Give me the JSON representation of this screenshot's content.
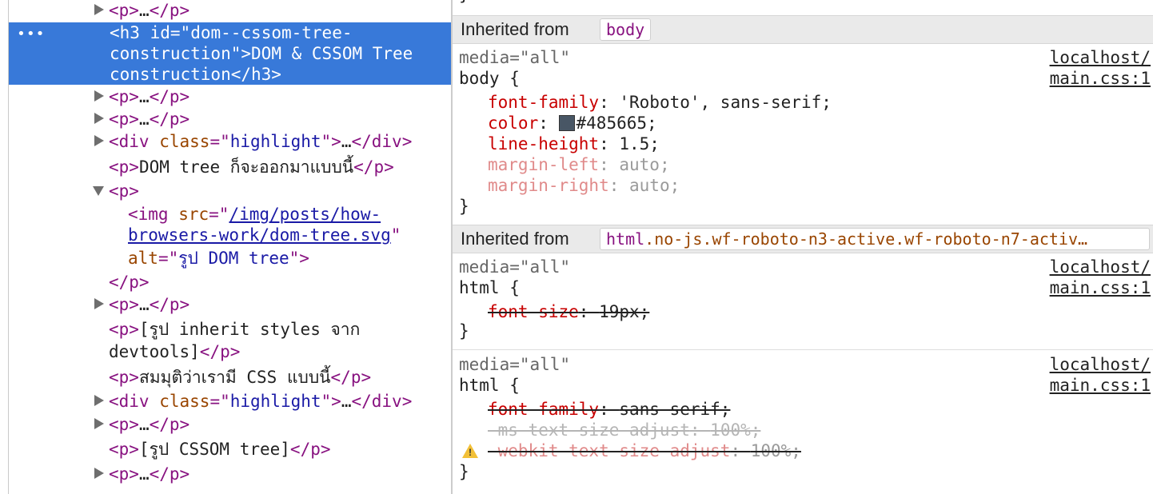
{
  "dom": {
    "line0": {
      "open": "<p>",
      "ellipsis": "…",
      "close": "</p>"
    },
    "selected": {
      "dots": "•••",
      "line1": {
        "open": "<h3 ",
        "attr": "id",
        "eq": "=",
        "q1": "\"",
        "val": "dom--cssom-tree-"
      },
      "line2": {
        "val": "construction",
        "q2": "\"",
        "gt": ">",
        "text": "DOM & CSSOM Tree"
      },
      "line3": {
        "text": "construction",
        "close": "</h3>"
      }
    },
    "line4": {
      "open": "<p>",
      "ellipsis": "…",
      "close": "</p>"
    },
    "line5": {
      "open": "<p>",
      "ellipsis": "…",
      "close": "</p>"
    },
    "line6": {
      "open": "<div ",
      "attr": "class",
      "eq": "=\"",
      "val": "highlight",
      "q": "\">",
      "ellipsis": "…",
      "close": "</div>"
    },
    "line7": {
      "open": "<p>",
      "text": "DOM tree ก็จะออกมาแบบนี้",
      "close": "</p>"
    },
    "line8": {
      "open": "<p>"
    },
    "line9": {
      "open": "<img ",
      "attr": "src",
      "eq": "=\"",
      "link": "/img/posts/how-"
    },
    "line10": {
      "link": "browsers-work/dom-tree.svg",
      "q": "\""
    },
    "line11": {
      "attr": "alt",
      "eq": "=\"",
      "val": "รูป DOM tree",
      "q": "\">"
    },
    "line12": {
      "close": "</p>"
    },
    "line13": {
      "open": "<p>",
      "ellipsis": "…",
      "close": "</p>"
    },
    "line14": {
      "open": "<p>",
      "text": "[รูป inherit styles จาก"
    },
    "line15": {
      "text": "devtools]",
      "close": "</p>"
    },
    "line16": {
      "open": "<p>",
      "text": "สมมุติว่าเรามี CSS แบบนี้",
      "close": "</p>"
    },
    "line17": {
      "open": "<div ",
      "attr": "class",
      "eq": "=\"",
      "val": "highlight",
      "q": "\">",
      "ellipsis": "…",
      "close": "</div>"
    },
    "line18": {
      "open": "<p>",
      "ellipsis": "…",
      "close": "</p>"
    },
    "line19": {
      "open": "<p>",
      "text": "[รูป CSSOM tree]",
      "close": "</p>"
    },
    "line20": {
      "open": "<p>",
      "ellipsis": "…",
      "close": "</p>"
    }
  },
  "styles": {
    "brace_close": "}",
    "inherited_body": {
      "label": "Inherited from",
      "chip": "body"
    },
    "rule_body": {
      "media": "media=\"all\"",
      "selector": "body {",
      "src1": "localhost/",
      "src2": "main.css:1",
      "p1": {
        "name": "font-family",
        "value": "'Roboto', sans-serif;"
      },
      "p2": {
        "name": "color",
        "value": "#485665;"
      },
      "p3": {
        "name": "line-height",
        "value": "1.5;"
      },
      "p4": {
        "name": "margin-left",
        "value": "auto;"
      },
      "p5": {
        "name": "margin-right",
        "value": "auto;"
      },
      "close": "}"
    },
    "inherited_html": {
      "label": "Inherited from",
      "chip_tag": "html",
      "chip_cls": ".no-js.wf-roboto-n3-active.wf-roboto-n7-activ…"
    },
    "rule_html1": {
      "media": "media=\"all\"",
      "selector": "html {",
      "src1": "localhost/",
      "src2": "main.css:1",
      "p1": {
        "name": "font-size",
        "value": "19px;"
      },
      "close": "}"
    },
    "rule_html2": {
      "media": "media=\"all\"",
      "selector": "html {",
      "src1": "localhost/",
      "src2": "main.css:1",
      "p1": {
        "name": "font-family",
        "value": "sans-serif;"
      },
      "p2": {
        "name": "-ms-text-size-adjust",
        "value": "100%;"
      },
      "p3": {
        "name": "-webkit-text-size-adjust",
        "value": "100%;"
      },
      "close": "}"
    }
  },
  "colors": {
    "selection": "#3879d9",
    "swatch": "#485665"
  }
}
